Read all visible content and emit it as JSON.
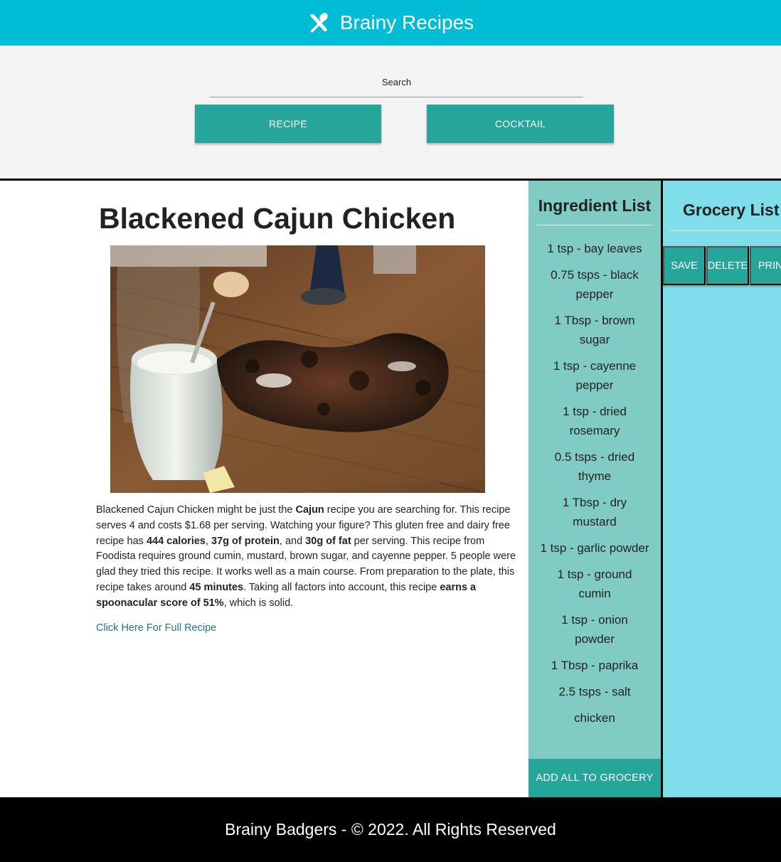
{
  "header": {
    "title": "Brainy Recipes",
    "icon": "utensils-crossed-icon"
  },
  "search": {
    "label": "Search",
    "value": "",
    "buttons": {
      "recipe": "RECIPE",
      "cocktail": "COCKTAIL"
    }
  },
  "recipe": {
    "title": "Blackened Cajun Chicken",
    "image_alt": "Blackened cajun chicken on a wooden board",
    "summary_parts": [
      "Blackened Cajun Chicken might be just the ",
      "Cajun",
      " recipe you are searching for. This recipe serves 4 and costs $1.68 per serving. Watching your figure? This gluten free and dairy free recipe has ",
      "444 calories",
      ", ",
      "37g of protein",
      ", and ",
      "30g of fat",
      " per serving. This recipe from Foodista requires ground cumin, mustard, brown sugar, and cayenne pepper. 5 people were glad they tried this recipe. It works well as a main course. From preparation to the plate, this recipe takes around ",
      "45 minutes",
      ". Taking all factors into account, this recipe ",
      "earns a spoonacular score of 51%",
      ", which is solid."
    ],
    "link_label": "Click Here For Full Recipe"
  },
  "ingredients": {
    "title": "Ingredient List",
    "items": [
      "1 tsp - bay leaves",
      "0.75 tsps - black pepper",
      "1 Tbsp - brown sugar",
      "1 tsp - cayenne pepper",
      "1 tsp - dried rosemary",
      "0.5 tsps - dried thyme",
      "1 Tbsp - dry mustard",
      "1 tsp - garlic powder",
      "1 tsp - ground cumin",
      "1 tsp - onion powder",
      "1 Tbsp - paprika",
      "2.5 tsps - salt",
      "chicken"
    ],
    "add_all_label": "ADD ALL TO GROCERY"
  },
  "grocery": {
    "title": "Grocery List",
    "save_label": "SAVE",
    "delete_label": "DELETE",
    "print_label": "PRINT"
  },
  "footer": {
    "text": "Brainy Badgers - © 2022. All Rights Reserved"
  },
  "colors": {
    "header_bg": "#00bcd4",
    "button_teal": "#26a69a",
    "ingredients_bg": "#80cbc4",
    "grocery_bg": "#80deea",
    "link": "#1d7a78",
    "footer_bg": "#000000"
  }
}
